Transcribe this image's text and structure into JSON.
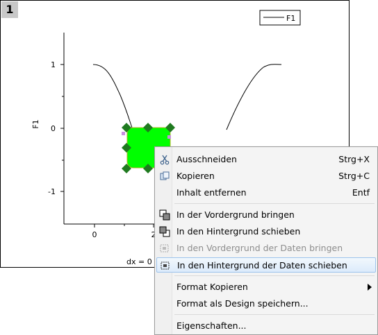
{
  "graph": {
    "layer_number": "1",
    "legend_label": "F1",
    "y_axis_label": "F1",
    "y_ticks": [
      "1",
      "0",
      "-1"
    ],
    "x_ticks": [
      "0",
      "2"
    ],
    "status_text": "dx = 0",
    "selected_object_color": "#00ff00",
    "handle_color": "#1f7a1f"
  },
  "menu": {
    "cut_label": "Ausschneiden",
    "cut_shortcut": "Strg+X",
    "copy_label": "Kopieren",
    "copy_shortcut": "Strg+C",
    "delete_label": "Inhalt entfernen",
    "delete_shortcut": "Entf",
    "bring_front_label": "In der Vordergrund bringen",
    "send_back_label": "In den Hintergrund schieben",
    "bring_data_front_label": "In den Vordergrund der Daten bringen",
    "send_data_back_label": "In den Hintergrund der Daten schieben",
    "copy_format_label": "Format Kopieren",
    "save_design_label": "Format als Design speichern...",
    "properties_label": "Eigenschaften..."
  }
}
